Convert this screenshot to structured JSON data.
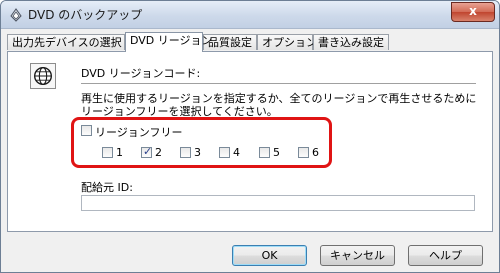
{
  "window": {
    "title": "DVD のバックアップ",
    "close_label": "x"
  },
  "tabs": [
    {
      "label": "出力先デバイスの選択",
      "active": false
    },
    {
      "label": "DVD リージョン",
      "active": true
    },
    {
      "label": "品質設定",
      "active": false
    },
    {
      "label": "オプション",
      "active": false
    },
    {
      "label": "書き込み設定",
      "active": false
    }
  ],
  "region": {
    "section_title": "DVD リージョンコード:",
    "description_line1": "再生に使用するリージョンを指定するか、全てのリージョンで再生させるために",
    "description_line2": "リージョンフリーを選択してください。",
    "region_free": {
      "label": "リージョンフリー",
      "checked": false
    },
    "codes": [
      {
        "label": "1",
        "checked": false
      },
      {
        "label": "2",
        "checked": true
      },
      {
        "label": "3",
        "checked": false
      },
      {
        "label": "4",
        "checked": false
      },
      {
        "label": "5",
        "checked": false
      },
      {
        "label": "6",
        "checked": false
      }
    ],
    "distributor_label": "配給元 ID:",
    "distributor_value": ""
  },
  "buttons": {
    "ok": "OK",
    "cancel": "キャンセル",
    "help": "ヘルプ"
  },
  "colors": {
    "highlight": "#e01414",
    "panel_bg": "#ffffff",
    "dialog_bg": "#f0f0f0"
  }
}
